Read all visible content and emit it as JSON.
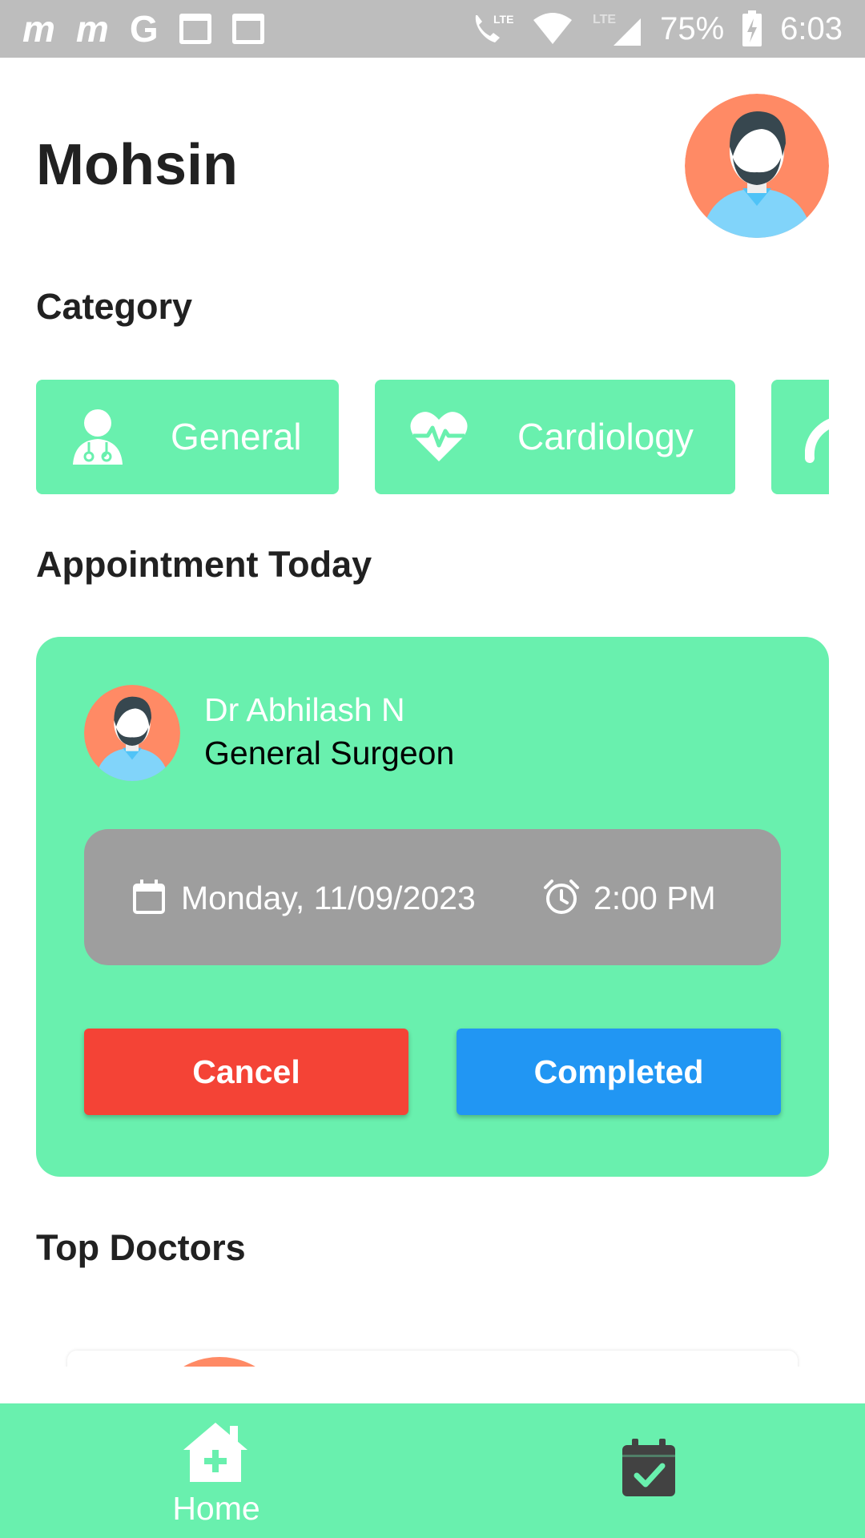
{
  "status_bar": {
    "app_glyphs": [
      "m",
      "m",
      "G"
    ],
    "battery": "75%",
    "time": "6:03",
    "icons": [
      "calendar-icon",
      "calendar-icon",
      "lte-call-icon",
      "wifi-icon",
      "lte-signal-icon",
      "battery-charging-icon"
    ]
  },
  "header": {
    "user_name": "Mohsin",
    "avatar_icon": "user-avatar-icon"
  },
  "sections": {
    "category": "Category",
    "appointment_today": "Appointment Today",
    "top_doctors": "Top Doctors"
  },
  "categories": [
    {
      "label": "General",
      "icon": "doctor-icon"
    },
    {
      "label": "Cardiology",
      "icon": "heartbeat-icon"
    }
  ],
  "appointment": {
    "doctor_name": "Dr Abhilash N",
    "specialty": "General Surgeon",
    "date": "Monday, 11/09/2023",
    "time": "2:00 PM",
    "cancel_label": "Cancel",
    "completed_label": "Completed"
  },
  "bottom_nav": {
    "home_label": "Home",
    "appointments_icon": "calendar-check-icon"
  },
  "colors": {
    "accent_green": "#69f0ae",
    "cancel_red": "#f44336",
    "completed_blue": "#2196f3",
    "date_box_grey": "#9e9e9e",
    "avatar_orange": "#ff8a65",
    "avatar_shirt": "#81d4fa"
  }
}
